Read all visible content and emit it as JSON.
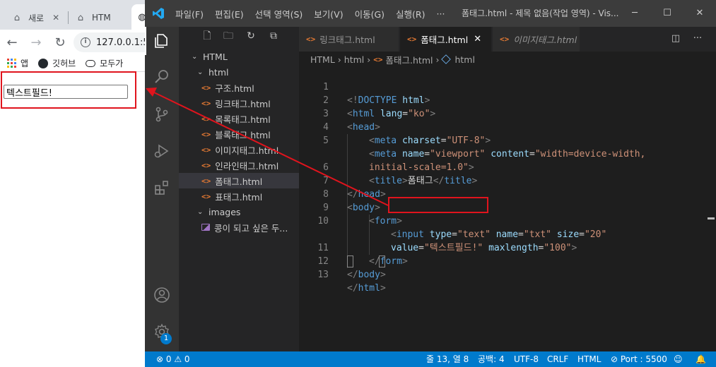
{
  "browser": {
    "tabs": [
      {
        "label": "새로",
        "icon": "home-icon"
      },
      {
        "label": "HTM",
        "icon": "home-icon"
      }
    ],
    "address": "127.0.0.1:5",
    "bookmarks": [
      {
        "label": "앱",
        "icon": "apps-icon"
      },
      {
        "label": "깃허브",
        "icon": "github-icon"
      },
      {
        "label": "모두가",
        "icon": "cloud-icon"
      }
    ],
    "demo_input_value": "텍스트필드!"
  },
  "vscode": {
    "menu": [
      "파일(F)",
      "편집(E)",
      "선택 영역(S)",
      "보기(V)",
      "이동(G)",
      "실행(R)",
      "···"
    ],
    "window_title": "폼태그.html - 제목 없음(작업 영역) - Vis...",
    "explorer": {
      "root": "HTML",
      "folder_html": "html",
      "files": [
        "구조.html",
        "링크태그.html",
        "목록태그.html",
        "블록태그.html",
        "이미지태그.html",
        "인라인태그.html",
        "폼태그.html",
        "표태그.html"
      ],
      "folder_images": "images",
      "image_file": "콩이 되고 싶은 두..."
    },
    "tabs": [
      {
        "label": "링크태그.html"
      },
      {
        "label": "폼태그.html"
      },
      {
        "label": "이미지태그.html"
      }
    ],
    "breadcrumb": [
      "HTML",
      "html",
      "폼태그.html",
      "html"
    ],
    "line_numbers": [
      "1",
      "2",
      "3",
      "4",
      "5",
      "",
      "6",
      "7",
      "8",
      "9",
      "10",
      "",
      "11",
      "12",
      "13"
    ],
    "code": {
      "l1": {
        "open": "<!",
        "tag": "DOCTYPE",
        "sp": " ",
        "attr": "html",
        "close": ">"
      },
      "l2": {
        "open": "<",
        "tag": "html",
        "attr": " lang",
        "eq": "=",
        "val": "\"ko\"",
        "close": ">"
      },
      "l3": {
        "open": "<",
        "tag": "head",
        "close": ">"
      },
      "l4": {
        "open": "<",
        "tag": "meta",
        "attr": " charset",
        "eq": "=",
        "val": "\"UTF-8\"",
        "close": ">"
      },
      "l5": {
        "open": "<",
        "tag": "meta",
        "attr1": " name",
        "eq": "=",
        "val1": "\"viewport\"",
        "attr2": " content",
        "val2": "\"width=device-width,"
      },
      "l5b": {
        "val": "initial-scale=1.0\"",
        "close": ">"
      },
      "l6": {
        "open": "<",
        "tag": "title",
        "close": ">",
        "text": "폼태그",
        "end_open": "</",
        "end_tag": "title",
        "end_close": ">"
      },
      "l7": {
        "open": "</",
        "tag": "head",
        "close": ">"
      },
      "l8": {
        "open": "<",
        "tag": "body",
        "close": ">"
      },
      "l9": {
        "open": "<",
        "tag": "form",
        "close": ">"
      },
      "l10": {
        "open": "<",
        "tag": "input",
        "attr1": " type",
        "eq": "=",
        "val1": "\"text\"",
        "attr2": " name",
        "val2": "\"txt\"",
        "attr3": " size",
        "val3": "\"20\""
      },
      "l10b": {
        "attr1": "value",
        "eq": "=",
        "val1": "\"텍스트필드!\"",
        "attr2": " maxlength",
        "val2": "\"100\"",
        "close": ">"
      },
      "l11": {
        "open": "</",
        "tag": "form",
        "close": ">"
      },
      "l12": {
        "open": "</",
        "tag": "body",
        "close": ">"
      },
      "l13": {
        "open": "</",
        "tag": "html",
        "close": ">"
      }
    },
    "status": {
      "errors": "⊗ 0 ⚠ 0",
      "position": "줄 13, 열 8",
      "spaces": "공백: 4",
      "encoding": "UTF-8",
      "eol": "CRLF",
      "language": "HTML",
      "port": "⊘ Port : 5500"
    },
    "badge_count": "1"
  },
  "colors": {
    "accent_blue": "#007acc",
    "highlight_red": "#e0141d",
    "html_file_orange": "#e37933"
  }
}
